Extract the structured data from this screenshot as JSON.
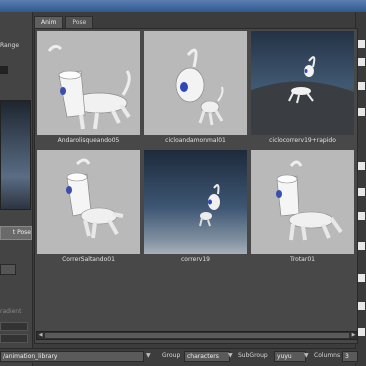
{
  "left": {
    "range_label": "Range",
    "button_label": "t Pose",
    "dim_text": "radient"
  },
  "tabs": [
    {
      "label": "Anim"
    },
    {
      "label": "Pose"
    }
  ],
  "thumbnails": [
    {
      "caption": "Andarolisqueando05"
    },
    {
      "caption": "cicloandamonmal01"
    },
    {
      "caption": "ciclocorrerv19+rapido"
    },
    {
      "caption": "CorrerSaltando01"
    },
    {
      "caption": "correrv19"
    },
    {
      "caption": "Trotar01"
    }
  ],
  "bottom": {
    "path_value": "/animation_library",
    "group_label": "Group",
    "group_value": "characters",
    "subgroup_label": "SubGroup",
    "subgroup_value": "yuyu",
    "columns_label": "Columns",
    "columns_value": "3"
  },
  "scroll": {
    "left_arrow": "◀",
    "right_arrow": "▶"
  },
  "icons": {
    "dropdown": "▼"
  }
}
